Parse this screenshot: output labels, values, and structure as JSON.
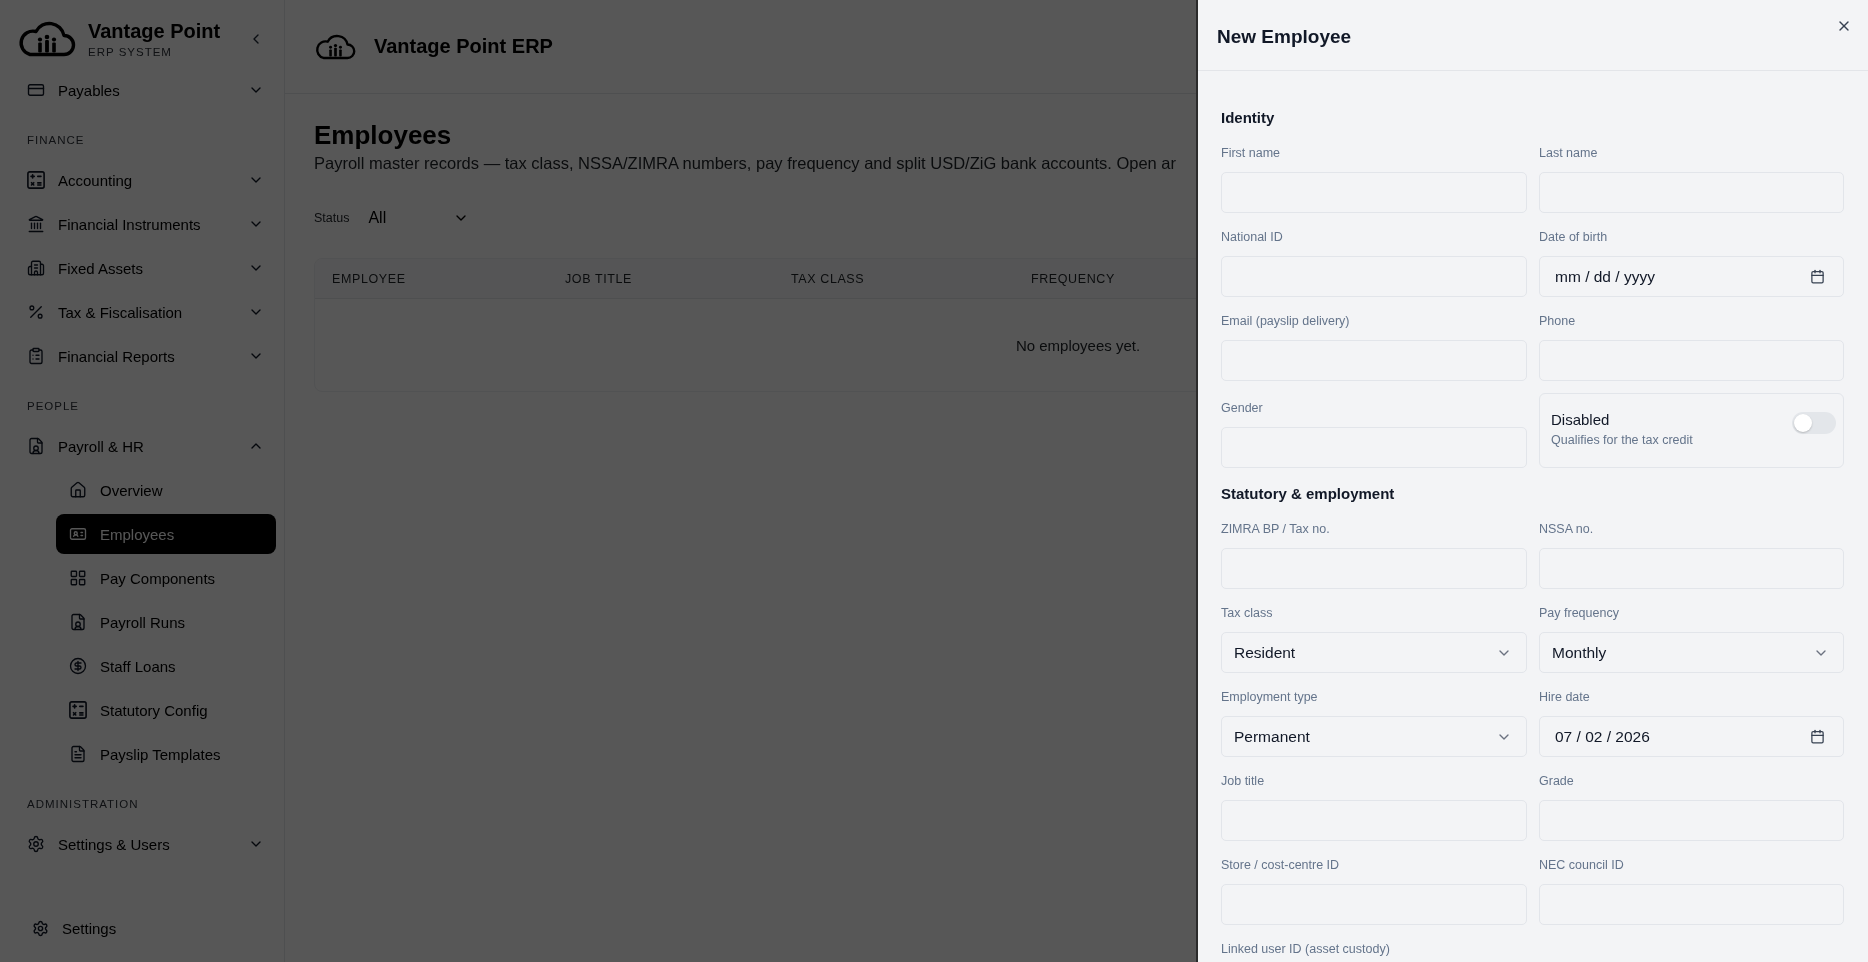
{
  "sidebar": {
    "brand": {
      "name": "Vantage Point",
      "subtitle": "ERP SYSTEM"
    },
    "sections": [
      {
        "items": [
          {
            "label": "Payables",
            "expanded": false
          }
        ]
      },
      {
        "heading": "FINANCE",
        "items": [
          {
            "label": "Accounting",
            "expanded": false
          },
          {
            "label": "Financial Instruments",
            "expanded": false
          },
          {
            "label": "Fixed Assets",
            "expanded": false
          },
          {
            "label": "Tax & Fiscalisation",
            "expanded": false
          },
          {
            "label": "Financial Reports",
            "expanded": false
          }
        ]
      },
      {
        "heading": "PEOPLE",
        "items": [
          {
            "label": "Payroll & HR",
            "expanded": true,
            "children": [
              {
                "label": "Overview",
                "selected": false
              },
              {
                "label": "Employees",
                "selected": true
              },
              {
                "label": "Pay Components",
                "selected": false
              },
              {
                "label": "Payroll Runs",
                "selected": false
              },
              {
                "label": "Staff Loans",
                "selected": false
              },
              {
                "label": "Statutory Config",
                "selected": false
              },
              {
                "label": "Payslip Templates",
                "selected": false
              }
            ]
          }
        ]
      },
      {
        "heading": "ADMINISTRATION",
        "items": [
          {
            "label": "Settings & Users",
            "expanded": false
          }
        ]
      }
    ],
    "footer": {
      "label": "Settings"
    }
  },
  "header": {
    "title": "Vantage Point ERP"
  },
  "page": {
    "title": "Employees",
    "description": "Payroll master records — tax class, NSSA/ZIMRA numbers, pay frequency and split USD/ZiG bank accounts. Open ar",
    "filter": {
      "label": "Status",
      "value": "All"
    },
    "table": {
      "columns": [
        "EMPLOYEE",
        "JOB TITLE",
        "TAX CLASS",
        "FREQUENCY"
      ],
      "empty_message": "No employees yet."
    }
  },
  "drawer": {
    "title": "New Employee",
    "sections": [
      {
        "title": "Identity",
        "fields": [
          {
            "kind": "text",
            "label": "First name"
          },
          {
            "kind": "text",
            "label": "Last name"
          },
          {
            "kind": "text",
            "label": "National ID"
          },
          {
            "kind": "date",
            "label": "Date of birth",
            "placeholder": "mm / dd / yyyy"
          },
          {
            "kind": "text",
            "label": "Email (payslip delivery)"
          },
          {
            "kind": "text",
            "label": "Phone"
          },
          {
            "kind": "text",
            "label": "Gender"
          },
          {
            "kind": "toggle",
            "label": "Disabled",
            "description": "Qualifies for the tax credit",
            "on": false
          }
        ]
      },
      {
        "title": "Statutory & employment",
        "fields": [
          {
            "kind": "text",
            "label": "ZIMRA BP / Tax no."
          },
          {
            "kind": "text",
            "label": "NSSA no."
          },
          {
            "kind": "select",
            "label": "Tax class",
            "value": "Resident"
          },
          {
            "kind": "select",
            "label": "Pay frequency",
            "value": "Monthly"
          },
          {
            "kind": "select",
            "label": "Employment type",
            "value": "Permanent"
          },
          {
            "kind": "date",
            "label": "Hire date",
            "value": "07 / 02 / 2026"
          },
          {
            "kind": "text",
            "label": "Job title"
          },
          {
            "kind": "text",
            "label": "Grade"
          },
          {
            "kind": "text",
            "label": "Store / cost-centre ID"
          },
          {
            "kind": "text",
            "label": "NEC council ID"
          },
          {
            "kind": "text",
            "label": "Linked user ID (asset custody)"
          }
        ]
      }
    ]
  }
}
